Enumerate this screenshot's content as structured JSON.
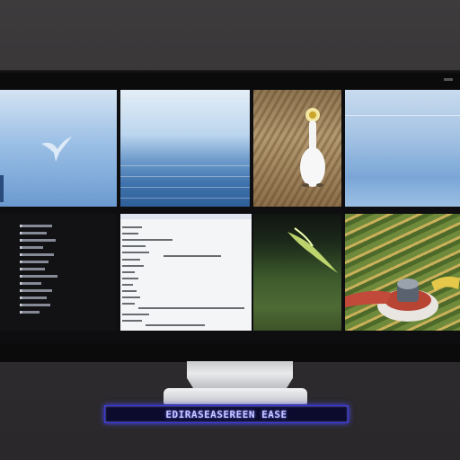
{
  "monitor": {
    "stand_label": "EDIRASEASEREEN EASE"
  },
  "screen": {
    "panes": [
      {
        "kind": "image",
        "subject": "bird-in-sky"
      },
      {
        "kind": "image",
        "subject": "ocean"
      },
      {
        "kind": "image",
        "subject": "white-goose-in-field"
      },
      {
        "kind": "image",
        "subject": "clear-sky"
      },
      {
        "kind": "text",
        "subject": "file-list"
      },
      {
        "kind": "text",
        "subject": "text-document"
      },
      {
        "kind": "image",
        "subject": "forest"
      },
      {
        "kind": "image",
        "subject": "rice-terraces"
      }
    ]
  },
  "colors": {
    "led_blue": "#3b3ad6",
    "bezel": "#0b0b0c",
    "wall": "#3d3b3c"
  }
}
